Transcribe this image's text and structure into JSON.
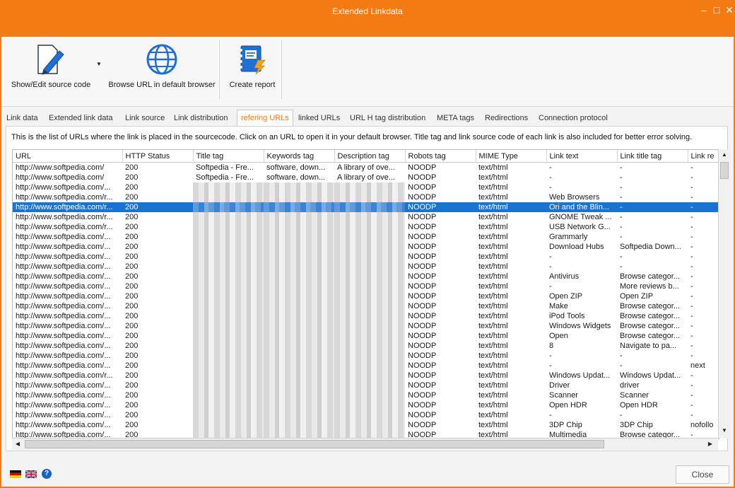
{
  "window": {
    "title": "Extended Linkdata"
  },
  "toolbar": {
    "show_edit_label": "Show/Edit source code",
    "browse_label": "Browse URL in default browser",
    "report_label": "Create report"
  },
  "tabs": [
    {
      "label": "Link data"
    },
    {
      "label": "Extended link data"
    },
    {
      "label": "Link source"
    },
    {
      "label": "Link distribution"
    },
    {
      "label": "refering URLs"
    },
    {
      "label": "linked URLs"
    },
    {
      "label": "URL H tag distribution"
    },
    {
      "label": "META tags"
    },
    {
      "label": "Redirections"
    },
    {
      "label": "Connection protocol"
    }
  ],
  "active_tab": "refering URLs",
  "description": "This is the list of URLs where the link is placed in the sourcecode. Click on an URL to open it in your default browser. Title tag and link source code of each link is also included for better error solving.",
  "table": {
    "columns": [
      "URL",
      "HTTP Status",
      "Title tag",
      "Keywords tag",
      "Description tag",
      "Robots tag",
      "MIME Type",
      "Link text",
      "Link title tag",
      "Link re"
    ],
    "rows": [
      {
        "url": "http://www.softpedia.com/",
        "status": "200",
        "title": "Softpedia - Fre...",
        "keywords": "software, down...",
        "descr": "A library of ove...",
        "robots": "NOODP",
        "mime": "text/html",
        "link_text": "-",
        "link_title": "-",
        "link_rel": "-",
        "blur": false
      },
      {
        "url": "http://www.softpedia.com/",
        "status": "200",
        "title": "Softpedia - Fre...",
        "keywords": "software, down...",
        "descr": "A library of ove...",
        "robots": "NOODP",
        "mime": "text/html",
        "link_text": "-",
        "link_title": "-",
        "link_rel": "-",
        "blur": false
      },
      {
        "url": "http://www.softpedia.com/...",
        "status": "200",
        "title": "",
        "keywords": "",
        "descr": "",
        "robots": "NOODP",
        "mime": "text/html",
        "link_text": "-",
        "link_title": "-",
        "link_rel": "-",
        "blur": true
      },
      {
        "url": "http://www.softpedia.com/r...",
        "status": "200",
        "title": "",
        "keywords": "",
        "descr": "",
        "robots": "NOODP",
        "mime": "text/html",
        "link_text": "Web Browsers",
        "link_title": "-",
        "link_rel": "-",
        "blur": true
      },
      {
        "url": "http://www.softpedia.com/r...",
        "status": "200",
        "title": "",
        "keywords": "",
        "descr": "",
        "robots": "NOODP",
        "mime": "text/html",
        "link_text": "Ori and the Blin...",
        "link_title": "-",
        "link_rel": "-",
        "blur": true,
        "selected": true
      },
      {
        "url": "http://www.softpedia.com/r...",
        "status": "200",
        "title": "",
        "keywords": "",
        "descr": "",
        "robots": "NOODP",
        "mime": "text/html",
        "link_text": "GNOME Tweak ...",
        "link_title": "-",
        "link_rel": "-",
        "blur": true
      },
      {
        "url": "http://www.softpedia.com/r...",
        "status": "200",
        "title": "",
        "keywords": "",
        "descr": "",
        "robots": "NOODP",
        "mime": "text/html",
        "link_text": "USB Network G...",
        "link_title": "-",
        "link_rel": "-",
        "blur": true
      },
      {
        "url": "http://www.softpedia.com/...",
        "status": "200",
        "title": "",
        "keywords": "",
        "descr": "",
        "robots": "NOODP",
        "mime": "text/html",
        "link_text": "Grammarly",
        "link_title": "-",
        "link_rel": "-",
        "blur": true
      },
      {
        "url": "http://www.softpedia.com/...",
        "status": "200",
        "title": "",
        "keywords": "",
        "descr": "",
        "robots": "NOODP",
        "mime": "text/html",
        "link_text": "Download Hubs",
        "link_title": "Softpedia Down...",
        "link_rel": "-",
        "blur": true
      },
      {
        "url": "http://www.softpedia.com/...",
        "status": "200",
        "title": "",
        "keywords": "",
        "descr": "",
        "robots": "NOODP",
        "mime": "text/html",
        "link_text": "-",
        "link_title": "-",
        "link_rel": "-",
        "blur": true
      },
      {
        "url": "http://www.softpedia.com/...",
        "status": "200",
        "title": "",
        "keywords": "",
        "descr": "",
        "robots": "NOODP",
        "mime": "text/html",
        "link_text": "-",
        "link_title": "-",
        "link_rel": "-",
        "blur": true
      },
      {
        "url": "http://www.softpedia.com/...",
        "status": "200",
        "title": "",
        "keywords": "",
        "descr": "",
        "robots": "NOODP",
        "mime": "text/html",
        "link_text": "Antivirus",
        "link_title": "Browse categor...",
        "link_rel": "-",
        "blur": true
      },
      {
        "url": "http://www.softpedia.com/...",
        "status": "200",
        "title": "",
        "keywords": "",
        "descr": "",
        "robots": "NOODP",
        "mime": "text/html",
        "link_text": "-",
        "link_title": "More reviews b...",
        "link_rel": "-",
        "blur": true
      },
      {
        "url": "http://www.softpedia.com/...",
        "status": "200",
        "title": "",
        "keywords": "",
        "descr": "",
        "robots": "NOODP",
        "mime": "text/html",
        "link_text": "Open ZIP",
        "link_title": "Open ZIP",
        "link_rel": "-",
        "blur": true
      },
      {
        "url": "http://www.softpedia.com/...",
        "status": "200",
        "title": "",
        "keywords": "",
        "descr": "",
        "robots": "NOODP",
        "mime": "text/html",
        "link_text": "Make",
        "link_title": "Browse categor...",
        "link_rel": "-",
        "blur": true
      },
      {
        "url": "http://www.softpedia.com/...",
        "status": "200",
        "title": "",
        "keywords": "",
        "descr": "",
        "robots": "NOODP",
        "mime": "text/html",
        "link_text": "iPod Tools",
        "link_title": "Browse categor...",
        "link_rel": "-",
        "blur": true
      },
      {
        "url": "http://www.softpedia.com/...",
        "status": "200",
        "title": "",
        "keywords": "",
        "descr": "",
        "robots": "NOODP",
        "mime": "text/html",
        "link_text": "Windows Widgets",
        "link_title": "Browse categor...",
        "link_rel": "-",
        "blur": true
      },
      {
        "url": "http://www.softpedia.com/...",
        "status": "200",
        "title": "",
        "keywords": "",
        "descr": "",
        "robots": "NOODP",
        "mime": "text/html",
        "link_text": "Open",
        "link_title": "Browse categor...",
        "link_rel": "-",
        "blur": true
      },
      {
        "url": "http://www.softpedia.com/...",
        "status": "200",
        "title": "",
        "keywords": "",
        "descr": "",
        "robots": "NOODP",
        "mime": "text/html",
        "link_text": "8",
        "link_title": "Navigate to pa...",
        "link_rel": "-",
        "blur": true
      },
      {
        "url": "http://www.softpedia.com/...",
        "status": "200",
        "title": "",
        "keywords": "",
        "descr": "",
        "robots": "NOODP",
        "mime": "text/html",
        "link_text": "-",
        "link_title": "-",
        "link_rel": "-",
        "blur": true
      },
      {
        "url": "http://www.softpedia.com/...",
        "status": "200",
        "title": "",
        "keywords": "",
        "descr": "",
        "robots": "NOODP",
        "mime": "text/html",
        "link_text": "-",
        "link_title": "-",
        "link_rel": "next",
        "blur": true
      },
      {
        "url": "http://www.softpedia.com/r...",
        "status": "200",
        "title": "",
        "keywords": "",
        "descr": "",
        "robots": "NOODP",
        "mime": "text/html",
        "link_text": "Windows Updat...",
        "link_title": "Windows Updat...",
        "link_rel": "-",
        "blur": true
      },
      {
        "url": "http://www.softpedia.com/...",
        "status": "200",
        "title": "",
        "keywords": "",
        "descr": "",
        "robots": "NOODP",
        "mime": "text/html",
        "link_text": "Driver",
        "link_title": "driver",
        "link_rel": "-",
        "blur": true
      },
      {
        "url": "http://www.softpedia.com/...",
        "status": "200",
        "title": "",
        "keywords": "",
        "descr": "",
        "robots": "NOODP",
        "mime": "text/html",
        "link_text": "Scanner",
        "link_title": "Scanner",
        "link_rel": "-",
        "blur": true
      },
      {
        "url": "http://www.softpedia.com/...",
        "status": "200",
        "title": "",
        "keywords": "",
        "descr": "",
        "robots": "NOODP",
        "mime": "text/html",
        "link_text": "Open HDR",
        "link_title": "Open HDR",
        "link_rel": "-",
        "blur": true
      },
      {
        "url": "http://www.softpedia.com/...",
        "status": "200",
        "title": "",
        "keywords": "",
        "descr": "",
        "robots": "NOODP",
        "mime": "text/html",
        "link_text": "-",
        "link_title": "-",
        "link_rel": "-",
        "blur": true
      },
      {
        "url": "http://www.softpedia.com/...",
        "status": "200",
        "title": "",
        "keywords": "",
        "descr": "",
        "robots": "NOODP",
        "mime": "text/html",
        "link_text": "3DP Chip",
        "link_title": "3DP Chip",
        "link_rel": "nofollo",
        "blur": true
      },
      {
        "url": "http://www.softpedia.com/...",
        "status": "200",
        "title": "",
        "keywords": "",
        "descr": "",
        "robots": "NOODP",
        "mime": "text/html",
        "link_text": "Multimedia",
        "link_title": "Browse categor...",
        "link_rel": "-",
        "blur": true
      }
    ]
  },
  "footer": {
    "close_label": "Close",
    "help_label": "?"
  },
  "colors": {
    "accent": "#f47b13",
    "selection": "#1a73cf"
  },
  "icons": [
    "edit-document-icon",
    "globe-icon",
    "report-notebook-icon",
    "german-flag-icon",
    "uk-flag-icon",
    "help-icon"
  ]
}
